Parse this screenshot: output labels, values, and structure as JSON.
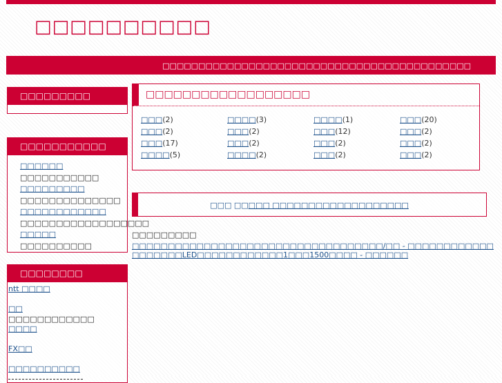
{
  "site": {
    "title": "□□□□□□□□□□",
    "tagline": "□□□□□□□□□□□□□□□□□□□□□□□□□□□□□□□□□□□□□□□□□□□"
  },
  "sidebar": {
    "box1_title": "□□□□□□□□□",
    "box2_title": "□□□□□□□□□□□",
    "box2_items": [
      {
        "link": "□□□□□□",
        "desc": "□□□□□□□□□□□"
      },
      {
        "link": "□□□□□□□□□",
        "desc": "□□□□□□□□□□□□□□"
      },
      {
        "link": "□□□□□□□□□□□□",
        "desc": "□□□□□□□□□□□□□□□□□□"
      },
      {
        "link": "□□□□□",
        "desc": "□□□□□□□□□□"
      }
    ],
    "box3_title": "□□□□□□□□",
    "box3_items": [
      {
        "link": "ntt □□□□"
      },
      {
        "link": "□□",
        "desc": "□□□□□□□□□□□□"
      },
      {
        "link": "□□□□"
      },
      {
        "link": "FX□□"
      },
      {
        "link": "□□□□□□□□□□"
      }
    ]
  },
  "main": {
    "category_title": "□□□□□□□□□□□□□□□□□□",
    "categories": [
      {
        "name": "□□□",
        "count": "(2)"
      },
      {
        "name": "□□□□",
        "count": "(3)"
      },
      {
        "name": "□□□□",
        "count": "(1)"
      },
      {
        "name": "□□□",
        "count": "(20)"
      },
      {
        "name": "□□□",
        "count": "(2)"
      },
      {
        "name": "□□□",
        "count": "(2)"
      },
      {
        "name": "□□□",
        "count": "(12)"
      },
      {
        "name": "□□□",
        "count": "(2)"
      },
      {
        "name": "□□□",
        "count": "(17)"
      },
      {
        "name": "□□□",
        "count": "(2)"
      },
      {
        "name": "□□□",
        "count": "(2)"
      },
      {
        "name": "□□□",
        "count": "(2)"
      },
      {
        "name": "□□□□",
        "count": "(5)"
      },
      {
        "name": "□□□□",
        "count": "(2)"
      },
      {
        "name": "□□□",
        "count": "(2)"
      },
      {
        "name": "□□□",
        "count": "(2)"
      }
    ],
    "banner_prefix": "□□□ □□",
    "banner_link": "□□□ □□□□□□□□□□□□□□□□□□□",
    "related_title": "□□□□□□□□□",
    "related_links": [
      "□□□□□□□□□□□□□□□□□□□□□□□□□□□□□□□□□□□/□□ - □□□□□□□□□□□□",
      "□□□□□□□LED□□□□□□□□□□□□1□□□1500□□□□ - □□□□□□"
    ]
  }
}
